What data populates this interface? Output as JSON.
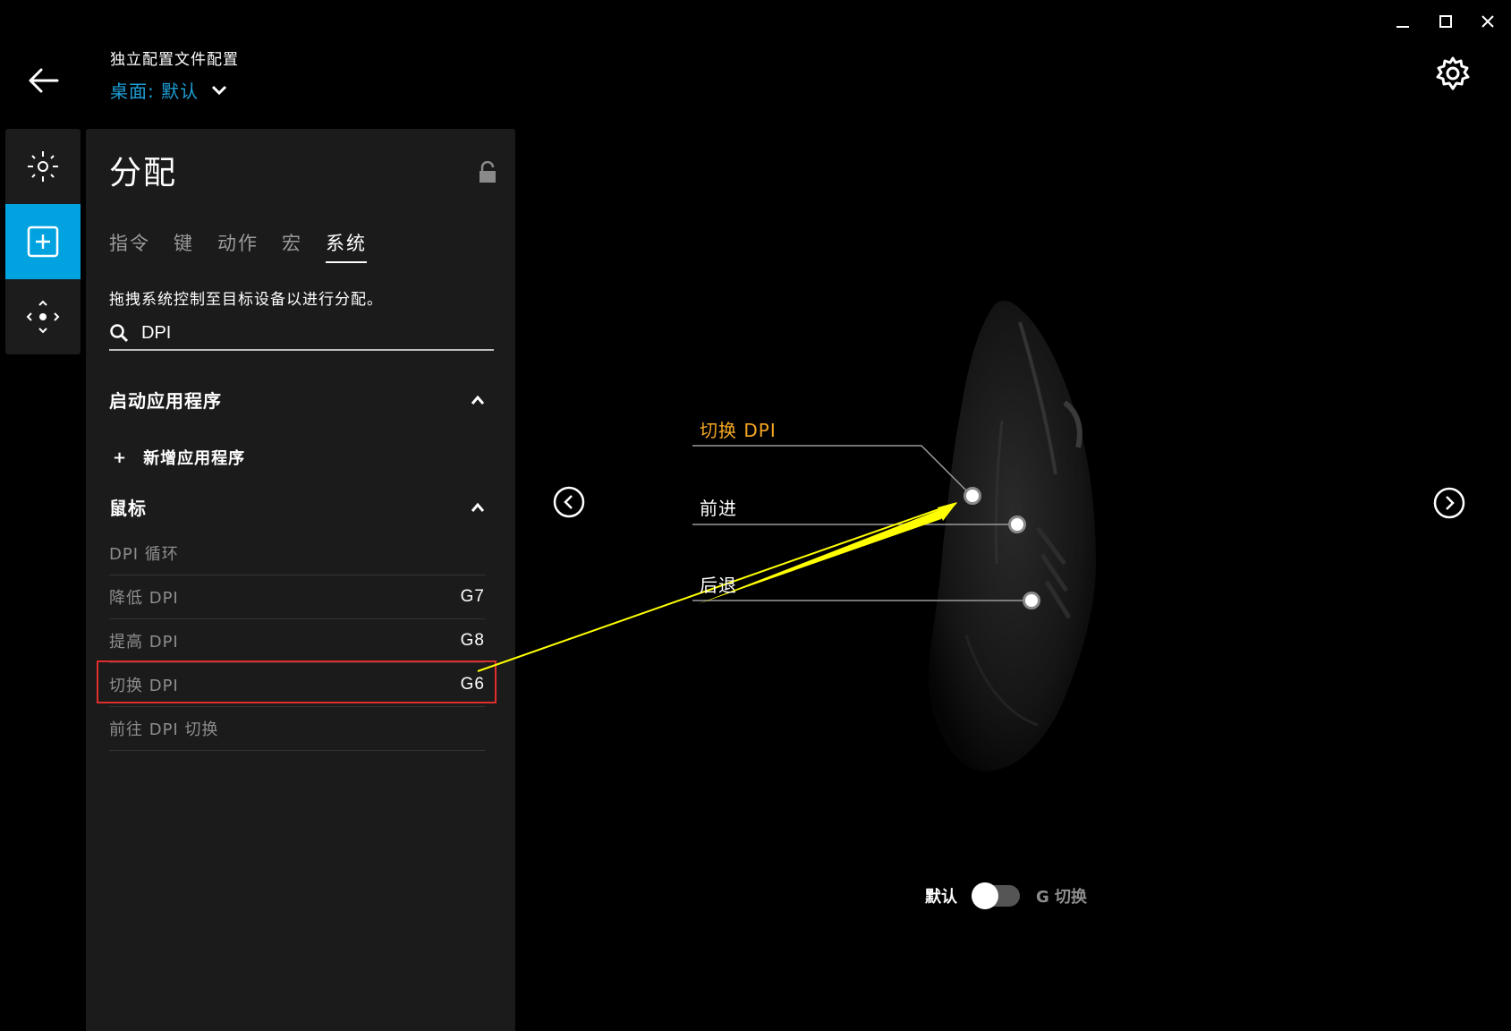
{
  "window": {
    "minimize_icon": "minimize-icon",
    "maximize_icon": "maximize-icon",
    "close_icon": "close-icon"
  },
  "header": {
    "profile_title": "独立配置文件配置",
    "profile_selected": "桌面: 默认"
  },
  "rail": {
    "items": [
      "lighting",
      "assignments",
      "sensitivity"
    ],
    "active": "assignments"
  },
  "panel": {
    "title": "分配",
    "tabs": [
      {
        "label": "指令",
        "active": false
      },
      {
        "label": "键",
        "active": false
      },
      {
        "label": "动作",
        "active": false
      },
      {
        "label": "宏",
        "active": false
      },
      {
        "label": "系统",
        "active": true
      }
    ],
    "hint": "拖拽系统控制至目标设备以进行分配。",
    "search": {
      "value": "DPI",
      "placeholder": ""
    },
    "sections": [
      {
        "title": "启动应用程序",
        "expanded": true,
        "add_label": "新增应用程序"
      },
      {
        "title": "鼠标",
        "expanded": true
      }
    ],
    "mouse_items": [
      {
        "label": "DPI 循环",
        "key": ""
      },
      {
        "label": "降低 DPI",
        "key": "G7"
      },
      {
        "label": "提高 DPI",
        "key": "G8"
      },
      {
        "label": "切换 DPI",
        "key": "G6"
      },
      {
        "label": "前往 DPI 切换",
        "key": ""
      }
    ],
    "highlighted_item": "切换 DPI"
  },
  "device": {
    "callouts": [
      {
        "label": "切换 DPI",
        "color": "#f5a623"
      },
      {
        "label": "前进",
        "color": "#ffffff"
      },
      {
        "label": "后退",
        "color": "#ffffff"
      }
    ],
    "toggle": {
      "left_label": "默认",
      "right_label": "G 切换",
      "state": "默认"
    }
  },
  "colors": {
    "accent": "#00a3e0",
    "profile_link": "#1ea0d8",
    "highlight_border": "#e02d2d",
    "annotation_arrow": "#ffff00",
    "callout_active": "#f5a623"
  }
}
